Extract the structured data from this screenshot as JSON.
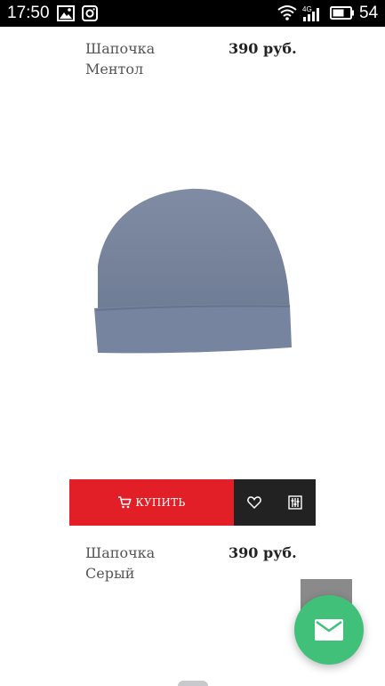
{
  "status_bar": {
    "time": "17:50",
    "network": "4G",
    "battery": "54"
  },
  "products": [
    {
      "name_line1": "Шапочка",
      "name_line2": "Ментол",
      "price": "390 руб."
    },
    {
      "name_line1": "Шапочка",
      "name_line2": "Серый",
      "price": "390 руб."
    }
  ],
  "actions": {
    "buy_label": "КУПИТЬ"
  },
  "colors": {
    "buy": "#e21f26",
    "icon_bar": "#222222",
    "fab": "#41c07a",
    "hat": "#7a879f"
  },
  "icons": {
    "cart": "cart-icon",
    "wishlist": "heart-icon",
    "compare": "compare-icon",
    "mail": "mail-icon"
  }
}
